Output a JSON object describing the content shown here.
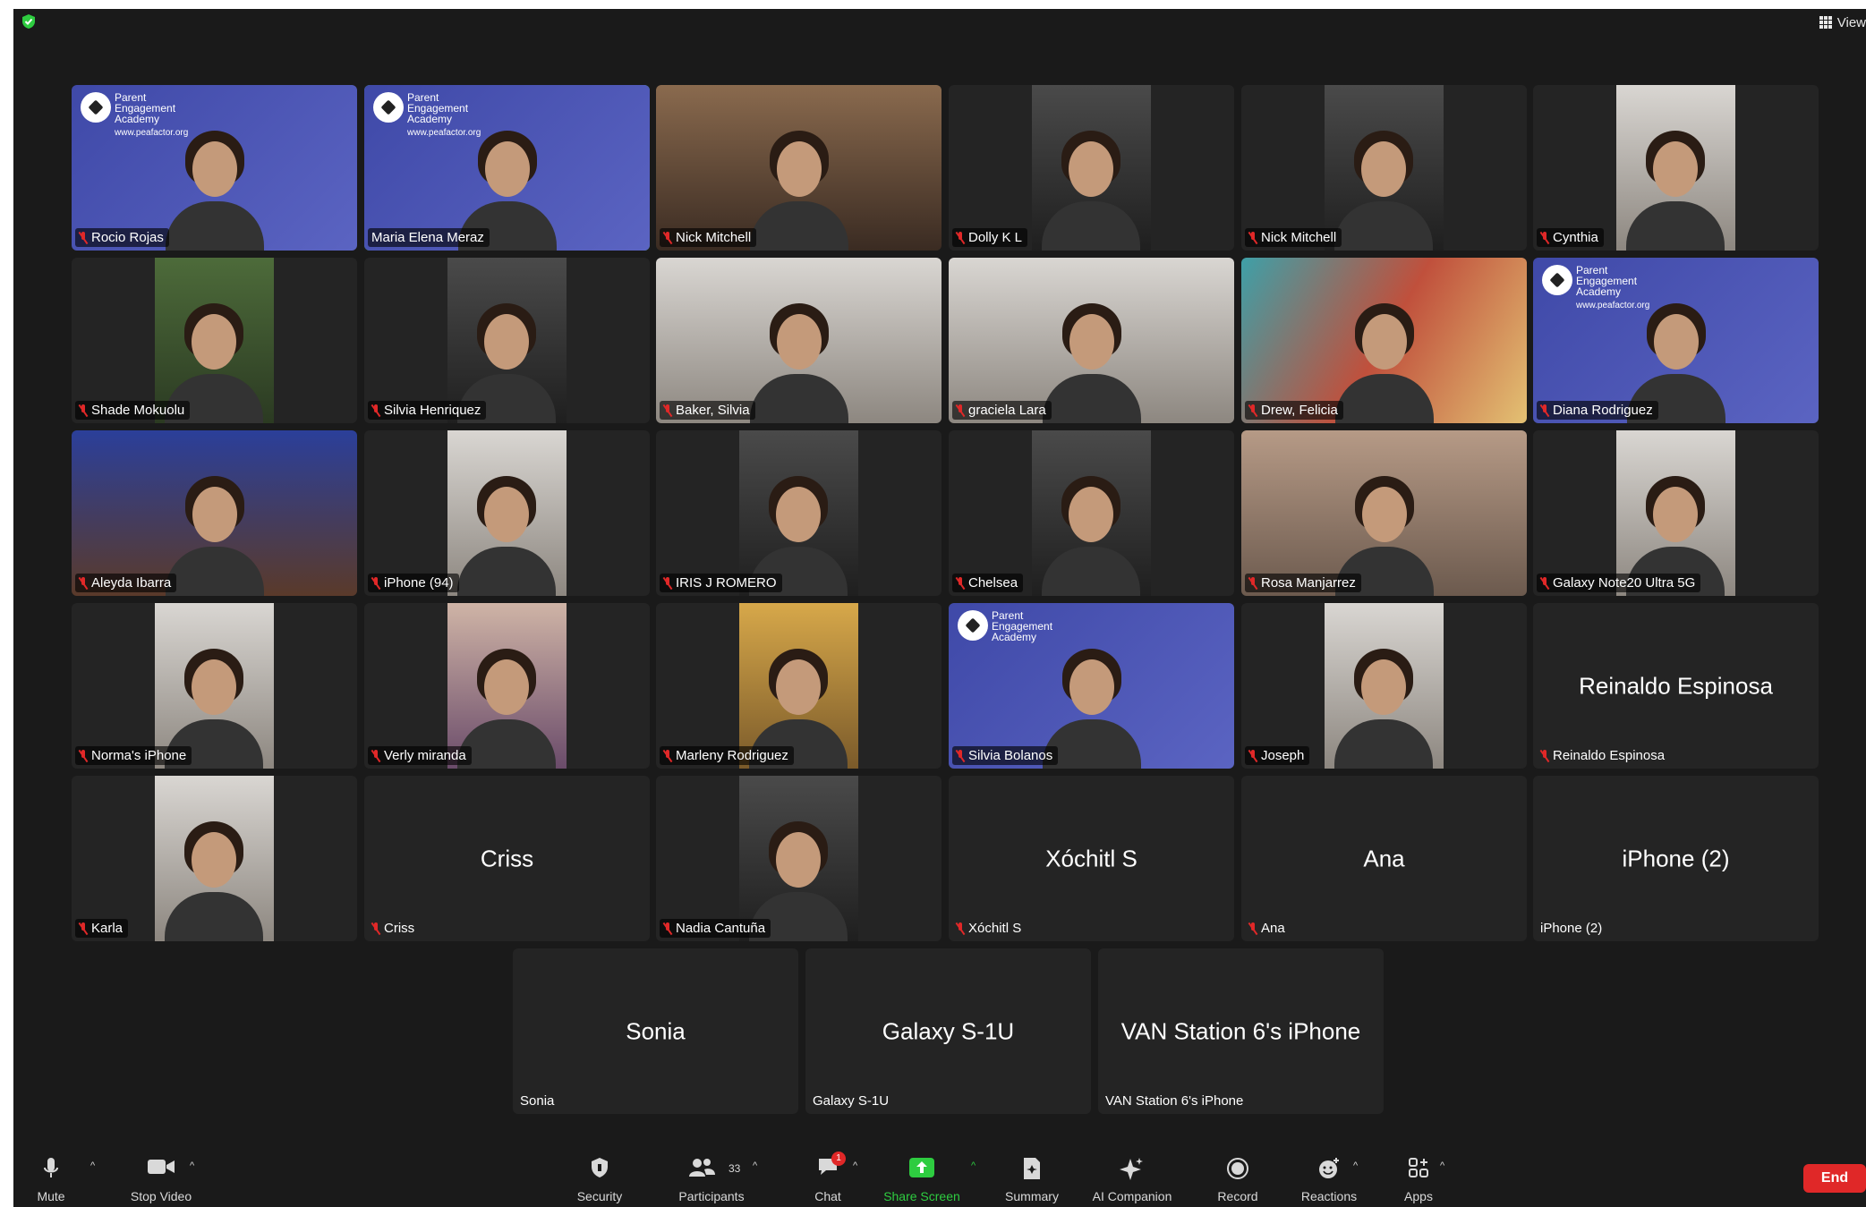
{
  "window": {
    "view_label": "View"
  },
  "tiles": [
    {
      "name": "Rocio Rojas",
      "muted": true,
      "video": "branded",
      "logo": true,
      "logo_text": "Parent Engagement Academy",
      "logo_url": "www.peafactor.org"
    },
    {
      "name": "Maria Elena Meraz",
      "muted": false,
      "video": "branded",
      "logo": true,
      "logo_text": "Parent Engagement Academy",
      "logo_url": "www.peafactor.org",
      "active": true
    },
    {
      "name": "Nick Mitchell",
      "muted": true,
      "video": "warm"
    },
    {
      "name": "Dolly K L",
      "muted": true,
      "video": "dark"
    },
    {
      "name": "Nick Mitchell",
      "muted": true,
      "video": "dark"
    },
    {
      "name": "Cynthia",
      "muted": true,
      "video": "light"
    },
    {
      "name": "Shade Mokuolu",
      "muted": true,
      "video": "green"
    },
    {
      "name": "Silvia Henriquez",
      "muted": true,
      "video": "dark"
    },
    {
      "name": "Baker, Silvia",
      "muted": true,
      "video": "light"
    },
    {
      "name": "graciela Lara",
      "muted": true,
      "video": "light"
    },
    {
      "name": "Drew, Felicia",
      "muted": true,
      "video": "mural"
    },
    {
      "name": "Diana Rodriguez",
      "muted": true,
      "video": "branded",
      "logo": true,
      "logo_text": "Parent Engagement Academy",
      "logo_url": "www.peafactor.org"
    },
    {
      "name": "Aleyda Ibarra",
      "muted": true,
      "video": "party"
    },
    {
      "name": "iPhone (94)",
      "muted": true,
      "video": "light"
    },
    {
      "name": "IRIS J ROMERO",
      "muted": true,
      "video": "dark"
    },
    {
      "name": "Chelsea",
      "muted": true,
      "video": "dark"
    },
    {
      "name": "Rosa Manjarrez",
      "muted": true,
      "video": "wall"
    },
    {
      "name": "Galaxy Note20 Ultra 5G",
      "muted": true,
      "video": "light"
    },
    {
      "name": "Norma's iPhone",
      "muted": true,
      "video": "light"
    },
    {
      "name": "Verly miranda",
      "muted": true,
      "video": "pink"
    },
    {
      "name": "Marleny Rodriguez",
      "muted": true,
      "video": "yellow"
    },
    {
      "name": "Silvia Bolanos",
      "muted": true,
      "video": "branded",
      "logo": true,
      "logo_text": "Parent Engagement Academy",
      "logo_url": ""
    },
    {
      "name": "Joseph",
      "muted": true,
      "video": "light"
    },
    {
      "name": "Reinaldo Espinosa",
      "muted": true,
      "video": "none",
      "big_name": "Reinaldo Espinosa"
    },
    {
      "name": "Karla",
      "muted": true,
      "video": "light"
    },
    {
      "name": "Criss",
      "muted": true,
      "video": "none",
      "big_name": "Criss"
    },
    {
      "name": "Nadia Cantuña",
      "muted": true,
      "video": "dark"
    },
    {
      "name": "Xóchitl S",
      "muted": true,
      "video": "none",
      "big_name": "Xóchitl S"
    },
    {
      "name": "Ana",
      "muted": true,
      "video": "none",
      "big_name": "Ana"
    },
    {
      "name": "iPhone (2)",
      "muted": false,
      "video": "none",
      "big_name": "iPhone (2)"
    },
    {
      "name": "Sonia",
      "muted": false,
      "video": "none",
      "big_name": "Sonia"
    },
    {
      "name": "Galaxy S-1U",
      "muted": false,
      "video": "none",
      "big_name": "Galaxy S-1U"
    },
    {
      "name": "VAN Station 6's iPhone",
      "muted": false,
      "video": "none",
      "big_name": "VAN Station 6's iPhone"
    }
  ],
  "toolbar": {
    "mute": "Mute",
    "stop_video": "Stop Video",
    "security": "Security",
    "participants": "Participants",
    "participants_count": "33",
    "chat": "Chat",
    "chat_badge": "1",
    "share_screen": "Share Screen",
    "summary": "Summary",
    "ai_companion": "AI Companion",
    "record": "Record",
    "reactions": "Reactions",
    "apps": "Apps",
    "end": "End"
  },
  "colors": {
    "accent_green": "#2ecc40",
    "muted_red": "#e02828",
    "tile_bg": "#242424",
    "app_bg": "#1a1a1a"
  },
  "icons": [
    "shield-icon",
    "grid-icon",
    "mic-icon",
    "video-camera-icon",
    "security-shield-icon",
    "participants-icon",
    "chat-bubble-icon",
    "share-screen-icon",
    "summary-icon",
    "sparkle-icon",
    "record-icon",
    "reaction-smiley-icon",
    "apps-icon",
    "mic-off-icon"
  ]
}
